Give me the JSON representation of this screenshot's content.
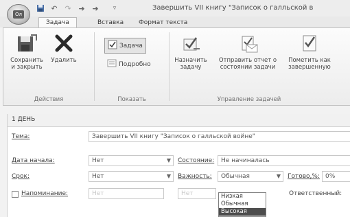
{
  "window": {
    "title": "Завершить VII книгу \"Записок о галльской в",
    "qat": [
      "save-icon",
      "undo-icon",
      "redo-icon",
      "up-icon",
      "down-icon",
      "customize-icon"
    ]
  },
  "tabs": [
    {
      "label": "Задача",
      "active": true
    },
    {
      "label": "Вставка",
      "active": false
    },
    {
      "label": "Формат текста",
      "active": false
    }
  ],
  "ribbon": {
    "actions": {
      "group_label": "Действия",
      "save_close": {
        "line1": "Сохранить",
        "line2": "и закрыть"
      },
      "delete": "Удалить"
    },
    "show": {
      "group_label": "Показать",
      "task": "Задача",
      "details": "Подробно"
    },
    "manage": {
      "group_label": "Управление задачей",
      "assign": {
        "line1": "Назначить",
        "line2": "задачу"
      },
      "send_status": {
        "line1": "Отправить отчет о",
        "line2": "состоянии задачи"
      },
      "mark_complete": {
        "line1": "Пометить как",
        "line2": "завершенную"
      }
    }
  },
  "form": {
    "notice": "1 ДЕНЬ",
    "subject": {
      "label": "Тема:",
      "value": "Завершить VII книгу \"Записок о галльской войне\""
    },
    "start": {
      "label": "Дата начала:",
      "value": "Нет"
    },
    "status": {
      "label": "Состояние:",
      "value": "Не начиналась"
    },
    "due": {
      "label": "Срок:",
      "value": "Нет"
    },
    "priority": {
      "label": "Важность:",
      "value": "Обычная",
      "options": [
        "Низкая",
        "Обычная",
        "Высокая"
      ],
      "highlighted": 2
    },
    "percent": {
      "label": "Готово,%:",
      "value": "0%"
    },
    "reminder": {
      "label": "Напоминание:",
      "date": "Нет",
      "time": "Нет"
    },
    "owner": {
      "label": "Ответственный:"
    }
  }
}
